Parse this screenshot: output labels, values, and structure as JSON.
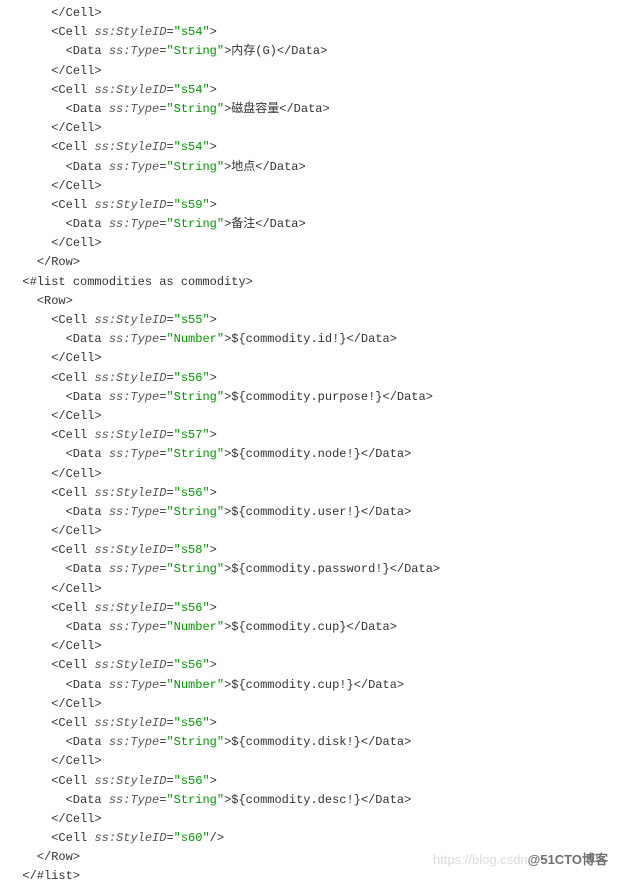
{
  "code_lines": [
    {
      "indent": 3,
      "parts": [
        {
          "type": "tag",
          "text": "</Cell>"
        }
      ]
    },
    {
      "indent": 3,
      "parts": [
        {
          "type": "tag",
          "text": "<Cell "
        },
        {
          "type": "attr-name",
          "text": "ss:StyleID"
        },
        {
          "type": "tag",
          "text": "="
        },
        {
          "type": "attr-value",
          "text": "\"s54\""
        },
        {
          "type": "tag",
          "text": ">"
        }
      ]
    },
    {
      "indent": 4,
      "parts": [
        {
          "type": "tag",
          "text": "<Data "
        },
        {
          "type": "attr-name",
          "text": "ss:Type"
        },
        {
          "type": "tag",
          "text": "="
        },
        {
          "type": "attr-value",
          "text": "\"String\""
        },
        {
          "type": "tag",
          "text": ">"
        },
        {
          "type": "text-content",
          "text": "内存(G)"
        },
        {
          "type": "tag",
          "text": "</Data>"
        }
      ]
    },
    {
      "indent": 3,
      "parts": [
        {
          "type": "tag",
          "text": "</Cell>"
        }
      ]
    },
    {
      "indent": 3,
      "parts": [
        {
          "type": "tag",
          "text": "<Cell "
        },
        {
          "type": "attr-name",
          "text": "ss:StyleID"
        },
        {
          "type": "tag",
          "text": "="
        },
        {
          "type": "attr-value",
          "text": "\"s54\""
        },
        {
          "type": "tag",
          "text": ">"
        }
      ]
    },
    {
      "indent": 4,
      "parts": [
        {
          "type": "tag",
          "text": "<Data "
        },
        {
          "type": "attr-name",
          "text": "ss:Type"
        },
        {
          "type": "tag",
          "text": "="
        },
        {
          "type": "attr-value",
          "text": "\"String\""
        },
        {
          "type": "tag",
          "text": ">"
        },
        {
          "type": "text-content",
          "text": "磁盘容量"
        },
        {
          "type": "tag",
          "text": "</Data>"
        }
      ]
    },
    {
      "indent": 3,
      "parts": [
        {
          "type": "tag",
          "text": "</Cell>"
        }
      ]
    },
    {
      "indent": 3,
      "parts": [
        {
          "type": "tag",
          "text": "<Cell "
        },
        {
          "type": "attr-name",
          "text": "ss:StyleID"
        },
        {
          "type": "tag",
          "text": "="
        },
        {
          "type": "attr-value",
          "text": "\"s54\""
        },
        {
          "type": "tag",
          "text": ">"
        }
      ]
    },
    {
      "indent": 4,
      "parts": [
        {
          "type": "tag",
          "text": "<Data "
        },
        {
          "type": "attr-name",
          "text": "ss:Type"
        },
        {
          "type": "tag",
          "text": "="
        },
        {
          "type": "attr-value",
          "text": "\"String\""
        },
        {
          "type": "tag",
          "text": ">"
        },
        {
          "type": "text-content",
          "text": "地点"
        },
        {
          "type": "tag",
          "text": "</Data>"
        }
      ]
    },
    {
      "indent": 3,
      "parts": [
        {
          "type": "tag",
          "text": "</Cell>"
        }
      ]
    },
    {
      "indent": 3,
      "parts": [
        {
          "type": "tag",
          "text": "<Cell "
        },
        {
          "type": "attr-name",
          "text": "ss:StyleID"
        },
        {
          "type": "tag",
          "text": "="
        },
        {
          "type": "attr-value",
          "text": "\"s59\""
        },
        {
          "type": "tag",
          "text": ">"
        }
      ]
    },
    {
      "indent": 4,
      "parts": [
        {
          "type": "tag",
          "text": "<Data "
        },
        {
          "type": "attr-name",
          "text": "ss:Type"
        },
        {
          "type": "tag",
          "text": "="
        },
        {
          "type": "attr-value",
          "text": "\"String\""
        },
        {
          "type": "tag",
          "text": ">"
        },
        {
          "type": "text-content",
          "text": "备注"
        },
        {
          "type": "tag",
          "text": "</Data>"
        }
      ]
    },
    {
      "indent": 3,
      "parts": [
        {
          "type": "tag",
          "text": "</Cell>"
        }
      ]
    },
    {
      "indent": 2,
      "parts": [
        {
          "type": "tag",
          "text": "</Row>"
        }
      ]
    },
    {
      "indent": 1,
      "parts": [
        {
          "type": "tag",
          "text": "<#list commodities as commodity>"
        }
      ]
    },
    {
      "indent": 2,
      "parts": [
        {
          "type": "tag",
          "text": "<Row>"
        }
      ]
    },
    {
      "indent": 3,
      "parts": [
        {
          "type": "tag",
          "text": "<Cell "
        },
        {
          "type": "attr-name",
          "text": "ss:StyleID"
        },
        {
          "type": "tag",
          "text": "="
        },
        {
          "type": "attr-value",
          "text": "\"s55\""
        },
        {
          "type": "tag",
          "text": ">"
        }
      ]
    },
    {
      "indent": 4,
      "parts": [
        {
          "type": "tag",
          "text": "<Data "
        },
        {
          "type": "attr-name",
          "text": "ss:Type"
        },
        {
          "type": "tag",
          "text": "="
        },
        {
          "type": "attr-value",
          "text": "\"Number\""
        },
        {
          "type": "tag",
          "text": ">"
        },
        {
          "type": "template-expr",
          "text": "${commodity.id!}"
        },
        {
          "type": "tag",
          "text": "</Data>"
        }
      ]
    },
    {
      "indent": 3,
      "parts": [
        {
          "type": "tag",
          "text": "</Cell>"
        }
      ]
    },
    {
      "indent": 3,
      "parts": [
        {
          "type": "tag",
          "text": "<Cell "
        },
        {
          "type": "attr-name",
          "text": "ss:StyleID"
        },
        {
          "type": "tag",
          "text": "="
        },
        {
          "type": "attr-value",
          "text": "\"s56\""
        },
        {
          "type": "tag",
          "text": ">"
        }
      ]
    },
    {
      "indent": 4,
      "parts": [
        {
          "type": "tag",
          "text": "<Data "
        },
        {
          "type": "attr-name",
          "text": "ss:Type"
        },
        {
          "type": "tag",
          "text": "="
        },
        {
          "type": "attr-value",
          "text": "\"String\""
        },
        {
          "type": "tag",
          "text": ">"
        },
        {
          "type": "template-expr",
          "text": "${commodity.purpose!}"
        },
        {
          "type": "tag",
          "text": "</Data>"
        }
      ]
    },
    {
      "indent": 3,
      "parts": [
        {
          "type": "tag",
          "text": "</Cell>"
        }
      ]
    },
    {
      "indent": 3,
      "parts": [
        {
          "type": "tag",
          "text": "<Cell "
        },
        {
          "type": "attr-name",
          "text": "ss:StyleID"
        },
        {
          "type": "tag",
          "text": "="
        },
        {
          "type": "attr-value",
          "text": "\"s57\""
        },
        {
          "type": "tag",
          "text": ">"
        }
      ]
    },
    {
      "indent": 4,
      "parts": [
        {
          "type": "tag",
          "text": "<Data "
        },
        {
          "type": "attr-name",
          "text": "ss:Type"
        },
        {
          "type": "tag",
          "text": "="
        },
        {
          "type": "attr-value",
          "text": "\"String\""
        },
        {
          "type": "tag",
          "text": ">"
        },
        {
          "type": "template-expr",
          "text": "${commodity.node!}"
        },
        {
          "type": "tag",
          "text": "</Data>"
        }
      ]
    },
    {
      "indent": 3,
      "parts": [
        {
          "type": "tag",
          "text": "</Cell>"
        }
      ]
    },
    {
      "indent": 3,
      "parts": [
        {
          "type": "tag",
          "text": "<Cell "
        },
        {
          "type": "attr-name",
          "text": "ss:StyleID"
        },
        {
          "type": "tag",
          "text": "="
        },
        {
          "type": "attr-value",
          "text": "\"s56\""
        },
        {
          "type": "tag",
          "text": ">"
        }
      ]
    },
    {
      "indent": 4,
      "parts": [
        {
          "type": "tag",
          "text": "<Data "
        },
        {
          "type": "attr-name",
          "text": "ss:Type"
        },
        {
          "type": "tag",
          "text": "="
        },
        {
          "type": "attr-value",
          "text": "\"String\""
        },
        {
          "type": "tag",
          "text": ">"
        },
        {
          "type": "template-expr",
          "text": "${commodity.user!}"
        },
        {
          "type": "tag",
          "text": "</Data>"
        }
      ]
    },
    {
      "indent": 3,
      "parts": [
        {
          "type": "tag",
          "text": "</Cell>"
        }
      ]
    },
    {
      "indent": 3,
      "parts": [
        {
          "type": "tag",
          "text": "<Cell "
        },
        {
          "type": "attr-name",
          "text": "ss:StyleID"
        },
        {
          "type": "tag",
          "text": "="
        },
        {
          "type": "attr-value",
          "text": "\"s58\""
        },
        {
          "type": "tag",
          "text": ">"
        }
      ]
    },
    {
      "indent": 4,
      "parts": [
        {
          "type": "tag",
          "text": "<Data "
        },
        {
          "type": "attr-name",
          "text": "ss:Type"
        },
        {
          "type": "tag",
          "text": "="
        },
        {
          "type": "attr-value",
          "text": "\"String\""
        },
        {
          "type": "tag",
          "text": ">"
        },
        {
          "type": "template-expr",
          "text": "${commodity.password!}"
        },
        {
          "type": "tag",
          "text": "</Data>"
        }
      ]
    },
    {
      "indent": 3,
      "parts": [
        {
          "type": "tag",
          "text": "</Cell>"
        }
      ]
    },
    {
      "indent": 3,
      "parts": [
        {
          "type": "tag",
          "text": "<Cell "
        },
        {
          "type": "attr-name",
          "text": "ss:StyleID"
        },
        {
          "type": "tag",
          "text": "="
        },
        {
          "type": "attr-value",
          "text": "\"s56\""
        },
        {
          "type": "tag",
          "text": ">"
        }
      ]
    },
    {
      "indent": 4,
      "parts": [
        {
          "type": "tag",
          "text": "<Data "
        },
        {
          "type": "attr-name",
          "text": "ss:Type"
        },
        {
          "type": "tag",
          "text": "="
        },
        {
          "type": "attr-value",
          "text": "\"Number\""
        },
        {
          "type": "tag",
          "text": ">"
        },
        {
          "type": "template-expr",
          "text": "${commodity.cup}"
        },
        {
          "type": "tag",
          "text": "</Data>"
        }
      ]
    },
    {
      "indent": 3,
      "parts": [
        {
          "type": "tag",
          "text": "</Cell>"
        }
      ]
    },
    {
      "indent": 3,
      "parts": [
        {
          "type": "tag",
          "text": "<Cell "
        },
        {
          "type": "attr-name",
          "text": "ss:StyleID"
        },
        {
          "type": "tag",
          "text": "="
        },
        {
          "type": "attr-value",
          "text": "\"s56\""
        },
        {
          "type": "tag",
          "text": ">"
        }
      ]
    },
    {
      "indent": 4,
      "parts": [
        {
          "type": "tag",
          "text": "<Data "
        },
        {
          "type": "attr-name",
          "text": "ss:Type"
        },
        {
          "type": "tag",
          "text": "="
        },
        {
          "type": "attr-value",
          "text": "\"Number\""
        },
        {
          "type": "tag",
          "text": ">"
        },
        {
          "type": "template-expr",
          "text": "${commodity.cup!}"
        },
        {
          "type": "tag",
          "text": "</Data>"
        }
      ]
    },
    {
      "indent": 3,
      "parts": [
        {
          "type": "tag",
          "text": "</Cell>"
        }
      ]
    },
    {
      "indent": 3,
      "parts": [
        {
          "type": "tag",
          "text": "<Cell "
        },
        {
          "type": "attr-name",
          "text": "ss:StyleID"
        },
        {
          "type": "tag",
          "text": "="
        },
        {
          "type": "attr-value",
          "text": "\"s56\""
        },
        {
          "type": "tag",
          "text": ">"
        }
      ]
    },
    {
      "indent": 4,
      "parts": [
        {
          "type": "tag",
          "text": "<Data "
        },
        {
          "type": "attr-name",
          "text": "ss:Type"
        },
        {
          "type": "tag",
          "text": "="
        },
        {
          "type": "attr-value",
          "text": "\"String\""
        },
        {
          "type": "tag",
          "text": ">"
        },
        {
          "type": "template-expr",
          "text": "${commodity.disk!}"
        },
        {
          "type": "tag",
          "text": "</Data>"
        }
      ]
    },
    {
      "indent": 3,
      "parts": [
        {
          "type": "tag",
          "text": "</Cell>"
        }
      ]
    },
    {
      "indent": 3,
      "parts": [
        {
          "type": "tag",
          "text": "<Cell "
        },
        {
          "type": "attr-name",
          "text": "ss:StyleID"
        },
        {
          "type": "tag",
          "text": "="
        },
        {
          "type": "attr-value",
          "text": "\"s56\""
        },
        {
          "type": "tag",
          "text": ">"
        }
      ]
    },
    {
      "indent": 4,
      "parts": [
        {
          "type": "tag",
          "text": "<Data "
        },
        {
          "type": "attr-name",
          "text": "ss:Type"
        },
        {
          "type": "tag",
          "text": "="
        },
        {
          "type": "attr-value",
          "text": "\"String\""
        },
        {
          "type": "tag",
          "text": ">"
        },
        {
          "type": "template-expr",
          "text": "${commodity.desc!}"
        },
        {
          "type": "tag",
          "text": "</Data>"
        }
      ]
    },
    {
      "indent": 3,
      "parts": [
        {
          "type": "tag",
          "text": "</Cell>"
        }
      ]
    },
    {
      "indent": 3,
      "parts": [
        {
          "type": "tag",
          "text": "<Cell "
        },
        {
          "type": "attr-name",
          "text": "ss:StyleID"
        },
        {
          "type": "tag",
          "text": "="
        },
        {
          "type": "attr-value",
          "text": "\"s60\""
        },
        {
          "type": "tag",
          "text": "/>"
        }
      ]
    },
    {
      "indent": 2,
      "parts": [
        {
          "type": "tag",
          "text": "</Row>"
        }
      ]
    },
    {
      "indent": 1,
      "parts": [
        {
          "type": "tag",
          "text": "</#list>"
        }
      ]
    }
  ],
  "watermark": {
    "url": "https://blog.csdn",
    "blog": "@51CTO博客"
  }
}
